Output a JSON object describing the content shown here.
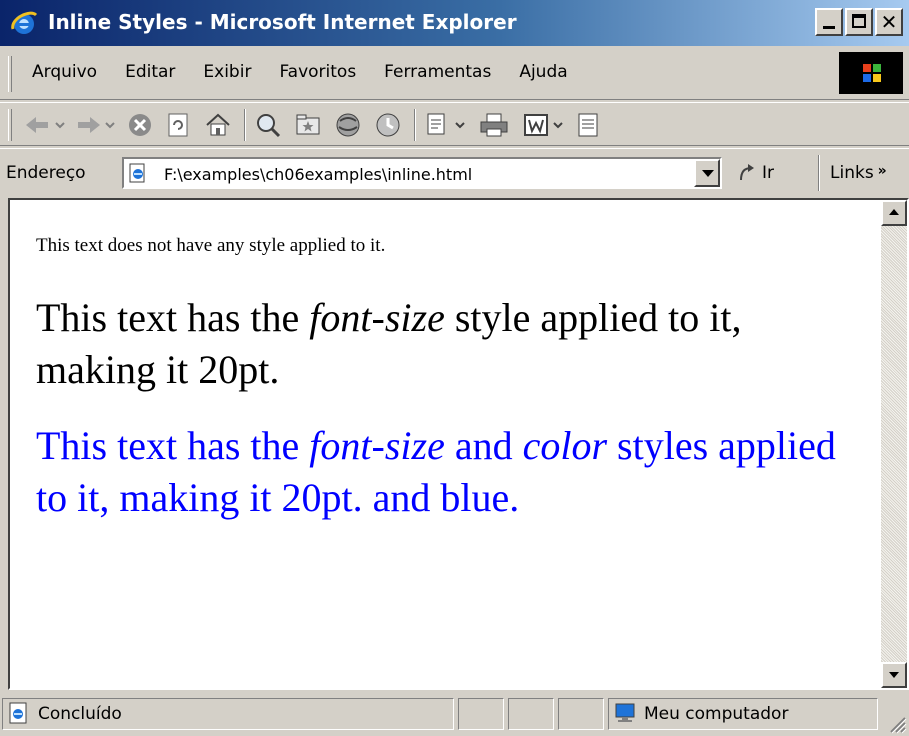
{
  "window": {
    "title": "Inline Styles - Microsoft Internet Explorer"
  },
  "menu": {
    "items": [
      "Arquivo",
      "Editar",
      "Exibir",
      "Favoritos",
      "Ferramentas",
      "Ajuda"
    ]
  },
  "address": {
    "label": "Endereço",
    "value": "F:\\examples\\ch06examples\\inline.html",
    "go_label": "Ir",
    "links_label": "Links"
  },
  "content": {
    "p1": "This text does not have any style applied to it.",
    "p2": {
      "pre": "This text has the ",
      "em": "font-size",
      "post": " style applied to it, making it 20pt."
    },
    "p3": {
      "pre": "This text has the ",
      "em1": "font-size",
      "mid": " and ",
      "em2": "color",
      "post": " styles applied to it, making it 20pt. and blue."
    }
  },
  "status": {
    "text": "Concluído",
    "zone": "Meu computador"
  },
  "colors": {
    "titlebar_start": "#0a246a",
    "titlebar_end": "#a6caf0",
    "chrome": "#d4d0c8",
    "blue_text": "#0000ff"
  },
  "icons": [
    "ie-logo-icon",
    "back-icon",
    "forward-icon",
    "stop-icon",
    "refresh-icon",
    "home-icon",
    "search-icon",
    "favorites-icon",
    "media-icon",
    "history-icon",
    "mail-icon",
    "print-icon",
    "edit-icon",
    "discuss-icon",
    "page-icon",
    "go-arrow-icon",
    "computer-icon",
    "windows-flag-icon"
  ]
}
